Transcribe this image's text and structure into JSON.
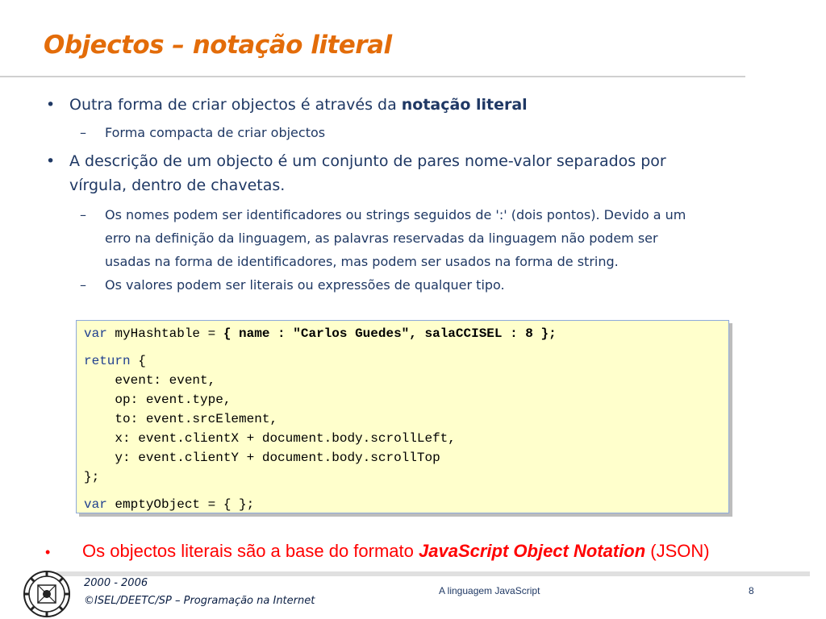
{
  "slide": {
    "title": "Objectos – notação literal",
    "bullets": {
      "b1_marker": "•",
      "b1_text": "Outra forma de criar objectos é através da ",
      "b1_bold": "notação literal",
      "b1_sub_marker": "–",
      "b1_sub": "Forma compacta de criar objectos",
      "b2_marker": "•",
      "b2_line1": "A descrição de um objecto é um conjunto de pares nome-valor separados por",
      "b2_line2": "vírgula, dentro de chavetas.",
      "b2_sub1_marker": "–",
      "b2_sub1_line1": "Os nomes podem ser identificadores ou strings seguidos de ':' (dois pontos). Devido a um",
      "b2_sub1_line2": "erro na definição da linguagem, as palavras reservadas da linguagem não podem ser",
      "b2_sub1_line3": "usadas na forma de identificadores, mas podem ser usados na forma de string.",
      "b2_sub2_marker": "–",
      "b2_sub2": "Os valores podem ser literais ou expressões de qualquer tipo."
    },
    "code": {
      "l1_kw": "var",
      "l1_plain": " myHashtable = ",
      "l1_bold": "{ name : \"Carlos Guedes\", salaCCISEL : 8 };",
      "l2_kw": "return",
      "l2_plain": " {",
      "l3": "    event: event,",
      "l4": "    op: event.type,",
      "l5": "    to: event.srcElement,",
      "l6": "    x: event.clientX + document.body.scrollLeft,",
      "l7": "    y: event.clientY + document.body.scrollTop",
      "l8": "};",
      "l9_kw": "var",
      "l9_plain": " emptyObject = { };"
    },
    "bottom": {
      "marker": "•",
      "text": "Os objectos literais são a base do formato ",
      "em": "JavaScript Object Notation",
      "tail": " (JSON)"
    }
  },
  "footer": {
    "years": "2000 - 2006",
    "credit": "©ISEL/DEETC/SP – Programação na Internet",
    "center": "A linguagem JavaScript",
    "page": "8"
  },
  "colors": {
    "title": "#e36c09",
    "body_text": "#1f3864",
    "code_bg": "#ffffcc",
    "keyword": "#1f3f8f",
    "bottom_text": "#ff0000"
  }
}
